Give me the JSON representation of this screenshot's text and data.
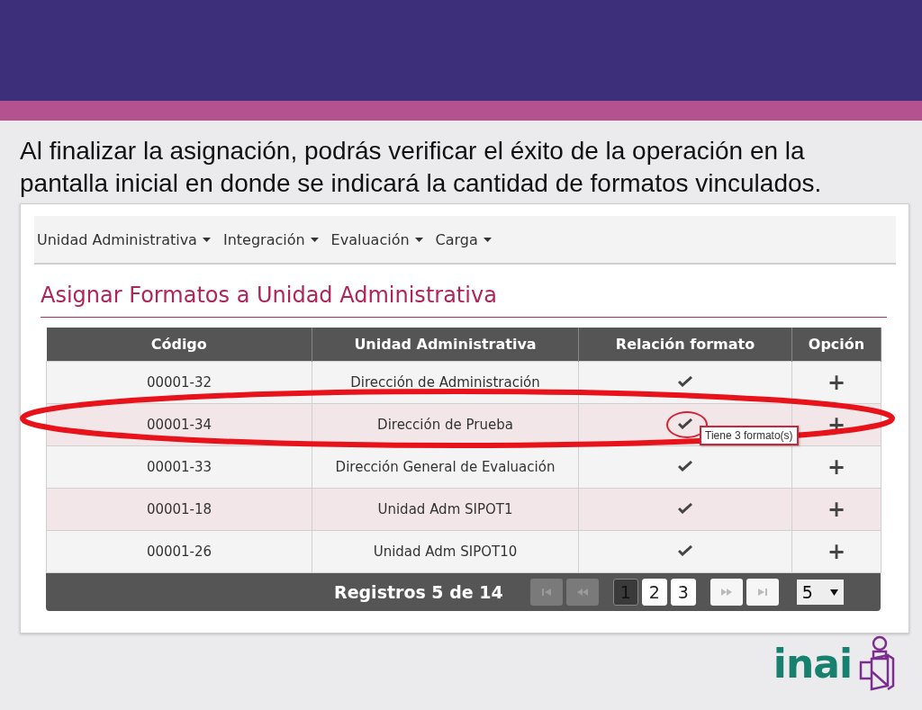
{
  "caption": "Al finalizar la asignación, podrás verificar el éxito de la operación en la pantalla inicial en donde se indicará la cantidad de formatos vinculados.",
  "menu": [
    {
      "label": "Unidad Administrativa"
    },
    {
      "label": "Integración"
    },
    {
      "label": "Evaluación"
    },
    {
      "label": "Carga"
    }
  ],
  "page_title": "Asignar Formatos a Unidad Administrativa",
  "table": {
    "columns": [
      "Código",
      "Unidad Administrativa",
      "Relación formato",
      "Opción"
    ],
    "rows": [
      {
        "code": "00001-32",
        "unit": "Dirección de Administración",
        "linked": true,
        "option": "+"
      },
      {
        "code": "00001-34",
        "unit": "Dirección de Prueba",
        "linked": true,
        "tooltip": "Tiene 3 formato(s)",
        "option": "+"
      },
      {
        "code": "00001-33",
        "unit": "Dirección General de Evaluación",
        "linked": true,
        "option": "+"
      },
      {
        "code": "00001-18",
        "unit": "Unidad Adm SIPOT1",
        "linked": true,
        "option": "+"
      },
      {
        "code": "00001-26",
        "unit": "Unidad Adm SIPOT10",
        "linked": true,
        "option": "+"
      }
    ]
  },
  "pager": {
    "summary": "Registros 5 de 14",
    "nav_before": [
      {
        "kind": "first",
        "disabled": true
      },
      {
        "kind": "prev",
        "disabled": true
      }
    ],
    "pages": [
      {
        "label": "1",
        "selected": true
      },
      {
        "label": "2",
        "selected": false
      },
      {
        "label": "3",
        "selected": false
      }
    ],
    "nav_after": [
      {
        "kind": "next",
        "disabled": false
      },
      {
        "kind": "last",
        "disabled": false
      }
    ],
    "page_size": "5"
  },
  "logo": "inai"
}
